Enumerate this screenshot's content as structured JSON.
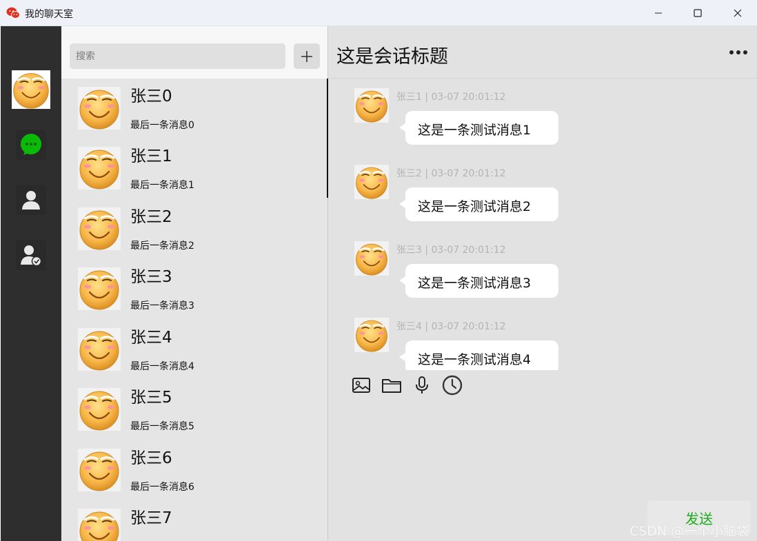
{
  "window": {
    "title": "我的聊天室",
    "icons": {
      "app": "wechat-logo-icon",
      "minimize": "minimize-icon",
      "maximize": "maximize-icon",
      "close": "close-icon"
    }
  },
  "nav": {
    "avatar": "user-avatar",
    "items": [
      {
        "name": "chat",
        "icon": "chat-bubble-icon",
        "color": "#09bb07"
      },
      {
        "name": "contacts",
        "icon": "person-icon"
      },
      {
        "name": "friend-requests",
        "icon": "person-check-icon"
      }
    ]
  },
  "search": {
    "placeholder": "搜索",
    "value": ""
  },
  "add_button": {
    "icon": "plus-icon"
  },
  "sessions": [
    {
      "name": "张三0",
      "last_message": "最后一条消息0"
    },
    {
      "name": "张三1",
      "last_message": "最后一条消息1"
    },
    {
      "name": "张三2",
      "last_message": "最后一条消息2"
    },
    {
      "name": "张三3",
      "last_message": "最后一条消息3"
    },
    {
      "name": "张三4",
      "last_message": "最后一条消息4"
    },
    {
      "name": "张三5",
      "last_message": "最后一条消息5"
    },
    {
      "name": "张三6",
      "last_message": "最后一条消息6"
    },
    {
      "name": "张三7",
      "last_message": ""
    }
  ],
  "chat": {
    "title": "这是会话标题",
    "more_icon": "more-dots-icon",
    "messages": [
      {
        "meta": "张三1 | 03-07 20:01:12",
        "text": "这是一条测试消息1"
      },
      {
        "meta": "张三2 | 03-07 20:01:12",
        "text": "这是一条测试消息2"
      },
      {
        "meta": "张三3 | 03-07 20:01:12",
        "text": "这是一条测试消息3"
      },
      {
        "meta": "张三4 | 03-07 20:01:12",
        "text": "这是一条测试消息4"
      }
    ],
    "toolbar": [
      "image-icon",
      "folder-icon",
      "microphone-icon",
      "clock-icon"
    ],
    "send_label": "发送"
  },
  "watermark": "CSDN @一个小脑袋",
  "colors": {
    "nav_bg": "#2e2e2e",
    "send_text": "#1aad19",
    "chat_bg": "#e2e2e2",
    "list_bg": "#e5e5e5"
  }
}
